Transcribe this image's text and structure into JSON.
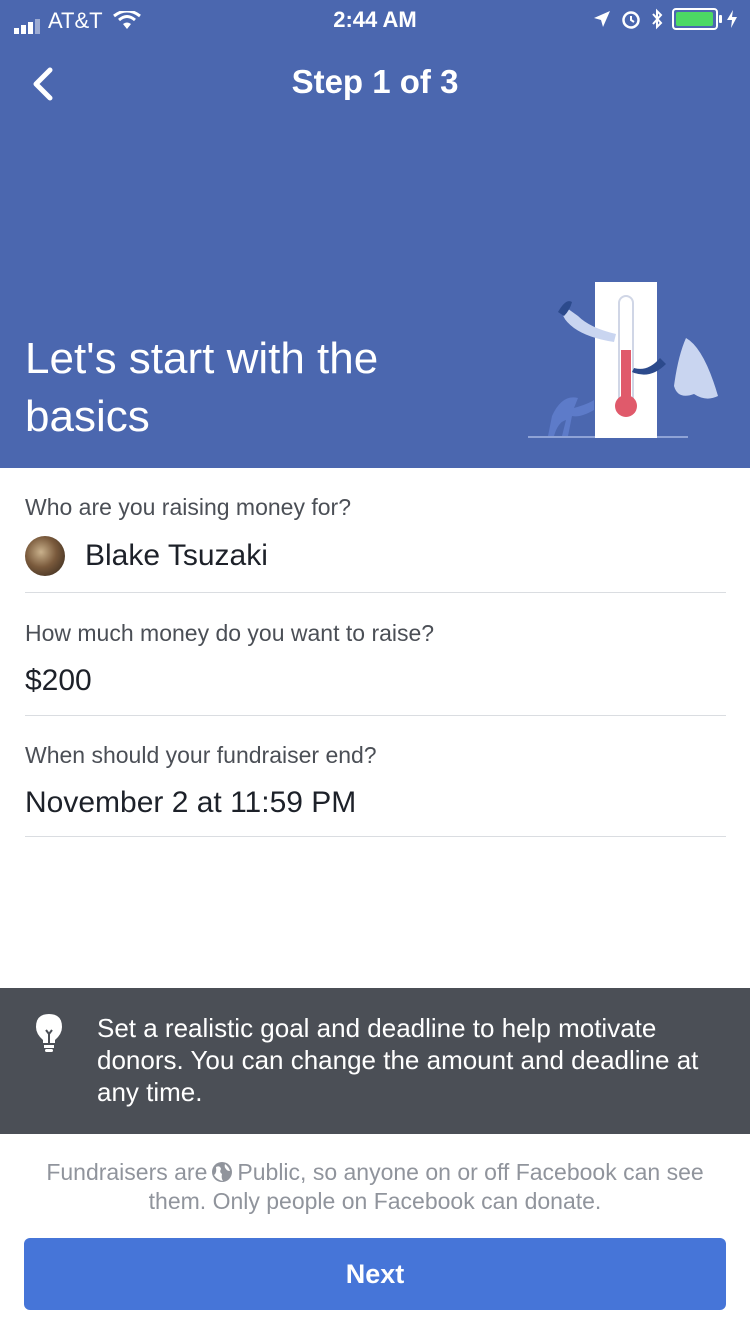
{
  "status_bar": {
    "carrier": "AT&T",
    "time": "2:44 AM",
    "battery_color": "#4cd964"
  },
  "header": {
    "step": "Step 1 of 3",
    "title": "Let's start with the basics",
    "background_color": "#4b67af",
    "back_icon": "chevron-left-icon",
    "illustration": "thermometer-with-people-illustration"
  },
  "form": {
    "recipient": {
      "label": "Who are you raising money for?",
      "value": "Blake Tsuzaki"
    },
    "goal": {
      "label": "How much money do you want to raise?",
      "value": "$200"
    },
    "end_date": {
      "label": "When should your fundraiser end?",
      "value": "November 2 at 11:59 PM"
    }
  },
  "tip": {
    "icon": "lightbulb-icon",
    "text": "Set a realistic goal and deadline to help motivate donors. You can change the amount and deadline at any time.",
    "background_color": "#4b4f56"
  },
  "privacy_note": {
    "before": "Fundraisers are",
    "after": "Public, so anyone on or off Facebook can see them. Only people on Facebook can donate.",
    "icon": "globe-icon"
  },
  "next_button": {
    "label": "Next",
    "color": "#4675d8"
  }
}
